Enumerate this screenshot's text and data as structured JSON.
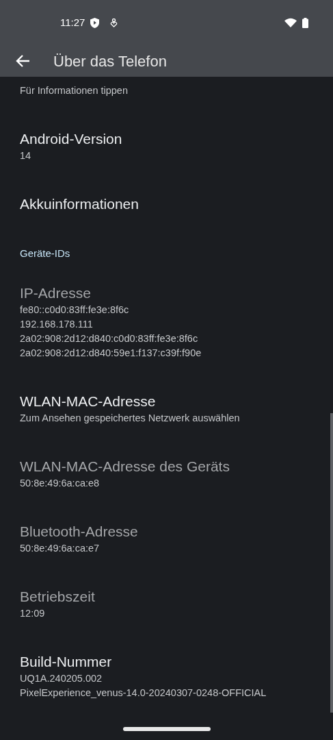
{
  "status_bar": {
    "time": "11:27"
  },
  "app_bar": {
    "title": "Über das Telefon"
  },
  "items": [
    {
      "kind": "item",
      "subtitles": [
        "Für Informationen tippen"
      ]
    },
    {
      "kind": "item",
      "title": "Android-Version",
      "subtitles": [
        "14"
      ],
      "disabled": false
    },
    {
      "kind": "item",
      "title": "Akkuinformationen",
      "disabled": false
    },
    {
      "kind": "section",
      "title": "Geräte-IDs"
    },
    {
      "kind": "item",
      "title": "IP-Adresse",
      "subtitles": [
        "fe80::c0d0:83ff:fe3e:8f6c",
        "192.168.178.111",
        "2a02:908:2d12:d840:c0d0:83ff:fe3e:8f6c",
        "2a02:908:2d12:d840:59e1:f137:c39f:f90e"
      ],
      "disabled": true
    },
    {
      "kind": "item",
      "title": "WLAN-MAC-Adresse",
      "subtitles": [
        "Zum Ansehen gespeichertes Netzwerk auswählen"
      ],
      "disabled": false
    },
    {
      "kind": "item",
      "title": "WLAN-MAC-Adresse des Geräts",
      "subtitles": [
        "50:8e:49:6a:ca:e8"
      ],
      "disabled": true
    },
    {
      "kind": "item",
      "title": "Bluetooth-Adresse",
      "subtitles": [
        "50:8e:49:6a:ca:e7"
      ],
      "disabled": true
    },
    {
      "kind": "item",
      "title": "Betriebszeit",
      "subtitles": [
        "12:09"
      ],
      "disabled": true
    },
    {
      "kind": "item",
      "title": "Build-Nummer",
      "subtitles": [
        "UQ1A.240205.002",
        "PixelExperience_venus-14.0-20240307-0248-OFFICIAL"
      ],
      "disabled": false
    }
  ]
}
